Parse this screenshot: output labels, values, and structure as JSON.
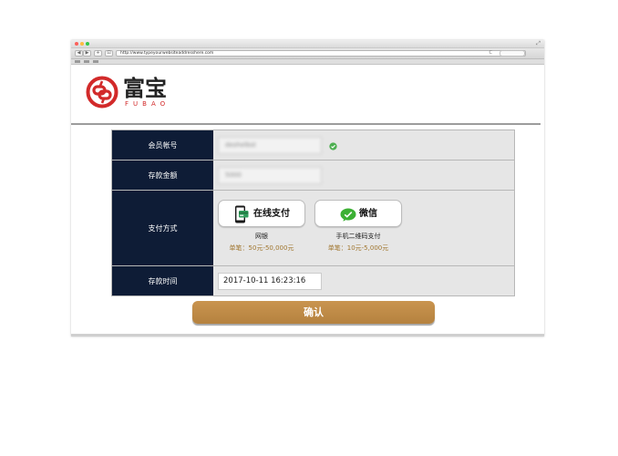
{
  "browser": {
    "url": "http://www.typeyourwebsiteaddresshere.com",
    "nav_back": "◀",
    "nav_forward": "▶",
    "nav_home": "+",
    "nav_reload": "⊡",
    "url_reload": "C",
    "resize": "⤢"
  },
  "brand": {
    "name_cn": "富宝",
    "name_en": "FUBAO",
    "logo_color": "#d22a2a"
  },
  "form": {
    "member_account": {
      "label": "会员帐号",
      "value": "deshelbst"
    },
    "deposit_amount": {
      "label": "存款金额",
      "value": "5000"
    },
    "payment_method": {
      "label": "支付方式",
      "options": [
        {
          "button_label": "在线支付",
          "name": "网银",
          "limit": "单笔：50元-50,000元",
          "icon": "mobile-card-icon"
        },
        {
          "button_label": "微信",
          "name": "手机二维码支付",
          "limit": "单笔：10元-5,000元",
          "icon": "wechat-icon"
        }
      ]
    },
    "deposit_time": {
      "label": "存款时间",
      "value": "2017-10-11 16:23:16"
    },
    "confirm_label": "确认"
  },
  "colors": {
    "label_bg": "#0e1c36",
    "confirm_bg": "#be8a46",
    "limit_text": "#a0762f",
    "check_green": "#4caf50",
    "wechat_green": "#3cb034"
  }
}
